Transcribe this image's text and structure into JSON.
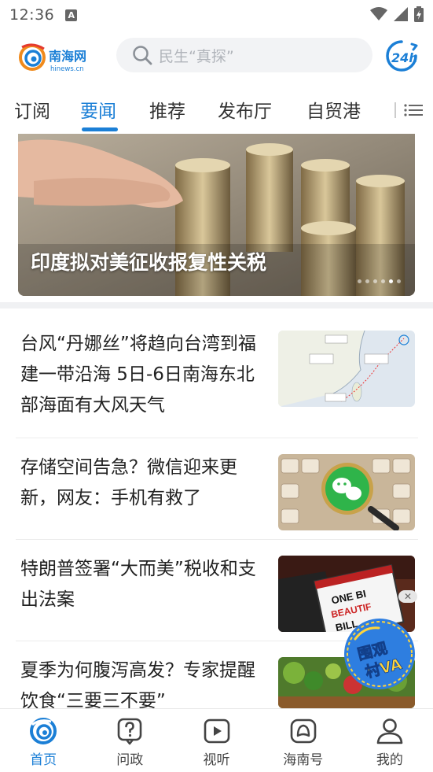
{
  "status_bar": {
    "time": "12:36",
    "notification_icon": "A"
  },
  "header": {
    "logo_name": "南海网",
    "logo_domain": "hinews.cn",
    "search_placeholder": "民生“真探”",
    "news24_label": "24h"
  },
  "tabs": [
    {
      "label": "订阅",
      "active": false
    },
    {
      "label": "要闻",
      "active": true
    },
    {
      "label": "推荐",
      "active": false
    },
    {
      "label": "发布厅",
      "active": false
    },
    {
      "label": "自贸港",
      "active": false
    }
  ],
  "banner": {
    "caption": "印度拟对美征收报复性关税",
    "slide_count": 6,
    "active_slide": 5
  },
  "news": [
    {
      "title": "台风“丹娜丝”将趋向台湾到福建一带沿海 5日-6日南海东北部海面有大风天气",
      "thumb": "typhoon-map"
    },
    {
      "title": "存储空间告急？微信迎来更新，网友：手机有救了",
      "thumb": "wechat-keyboard"
    },
    {
      "title": "特朗普签署“大而美”税收和支出法案",
      "thumb": "bill-sign"
    },
    {
      "title": "夏季为何腹泻高发？专家提醒饮食“三要三不要”",
      "thumb": "vegetables"
    }
  ],
  "float_badge": {
    "line1": "围观",
    "line2": "村VA"
  },
  "bottom_nav": [
    {
      "label": "首页",
      "icon": "home-swirl-icon",
      "active": true
    },
    {
      "label": "问政",
      "icon": "question-bubble-icon",
      "active": false
    },
    {
      "label": "视听",
      "icon": "play-icon",
      "active": false
    },
    {
      "label": "海南号",
      "icon": "island-icon",
      "active": false
    },
    {
      "label": "我的",
      "icon": "user-icon",
      "active": false
    }
  ],
  "colors": {
    "accent": "#1b7fd6",
    "logo_orange": "#f08a1c"
  }
}
